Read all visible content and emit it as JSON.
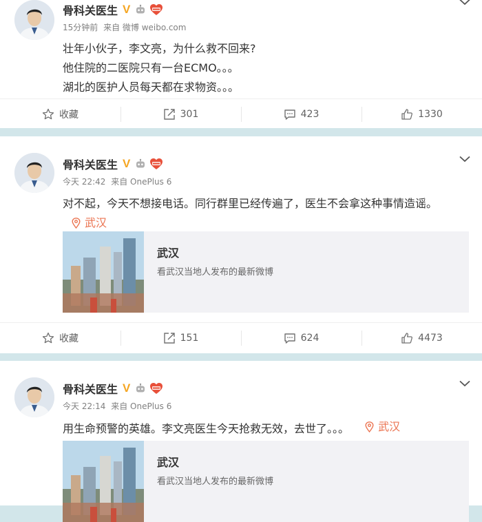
{
  "colors": {
    "accent_orange": "#eb7350",
    "verified": "#f5a623",
    "separator": "#d2e6ea"
  },
  "posts": [
    {
      "username": "骨科关医生",
      "time": "15分钟前",
      "source": "来自 微博 weibo.com",
      "lines": [
        "壮年小伙子，李文亮，为什么救不回来?",
        "他住院的二医院只有一台ECMO。。。",
        "湖北的医护人员每天都在求物资。。。"
      ],
      "actions": {
        "favorite": "收藏",
        "repost": "301",
        "comment": "423",
        "like": "1330"
      }
    },
    {
      "username": "骨科关医生",
      "time": "今天 22:42",
      "source": "来自 OnePlus 6",
      "text": "对不起，今天不想接电话。同行群里已经传遍了，医生不会拿这种事情造谣。",
      "location": "武汉",
      "card": {
        "title": "武汉",
        "desc": "看武汉当地人发布的最新微博"
      },
      "actions": {
        "favorite": "收藏",
        "repost": "151",
        "comment": "624",
        "like": "4473"
      }
    },
    {
      "username": "骨科关医生",
      "time": "今天 22:14",
      "source": "来自 OnePlus 6",
      "text": "用生命预警的英雄。李文亮医生今天抢救无效，去世了。。。",
      "location": "武汉",
      "card": {
        "title": "武汉",
        "desc": "看武汉当地人发布的最新微博"
      }
    }
  ],
  "badges": {
    "verified": "V",
    "robot_icon": "robot-icon",
    "heart_badge": "fan-heart-icon"
  }
}
